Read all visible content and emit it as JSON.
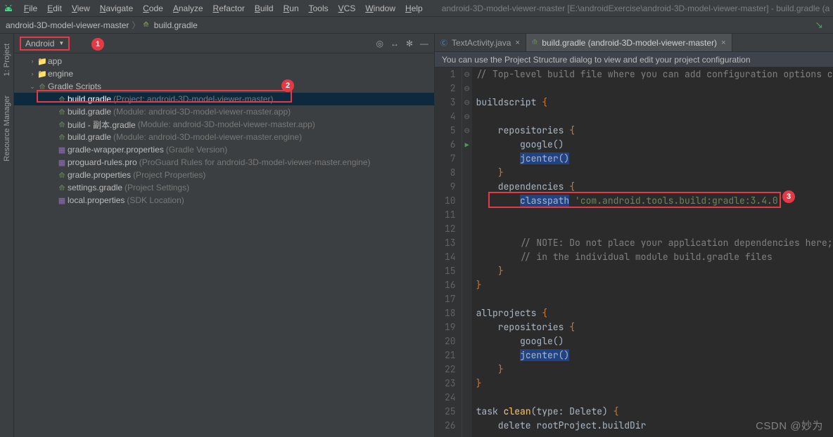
{
  "window_title": "android-3D-model-viewer-master [E:\\androidExercise\\android-3D-model-viewer-master] - build.gradle (android-",
  "menu": [
    "File",
    "Edit",
    "View",
    "Navigate",
    "Code",
    "Analyze",
    "Refactor",
    "Build",
    "Run",
    "Tools",
    "VCS",
    "Window",
    "Help"
  ],
  "breadcrumbs": {
    "project": "android-3D-model-viewer-master",
    "file": "build.gradle"
  },
  "sidebar_tools": {
    "project": "1: Project",
    "resource_manager": "Resource Manager"
  },
  "project_panel": {
    "view_mode": "Android"
  },
  "tree": [
    {
      "depth": 0,
      "arrow": "›",
      "icon": "folder",
      "label": "app",
      "hint": ""
    },
    {
      "depth": 0,
      "arrow": "›",
      "icon": "folder",
      "label": "engine",
      "hint": ""
    },
    {
      "depth": 0,
      "arrow": "⌄",
      "icon": "gradle",
      "label": "Gradle Scripts",
      "hint": ""
    },
    {
      "depth": 1,
      "arrow": "",
      "icon": "gradle",
      "label": "build.gradle",
      "hint": "(Project: android-3D-model-viewer-master)",
      "selected": true
    },
    {
      "depth": 1,
      "arrow": "",
      "icon": "gradle",
      "label": "build.gradle",
      "hint": "(Module: android-3D-model-viewer-master.app)"
    },
    {
      "depth": 1,
      "arrow": "",
      "icon": "gradle",
      "label": "build - 副本.gradle",
      "hint": "(Module: android-3D-model-viewer-master.app)"
    },
    {
      "depth": 1,
      "arrow": "",
      "icon": "gradle",
      "label": "build.gradle",
      "hint": "(Module: android-3D-model-viewer-master.engine)"
    },
    {
      "depth": 1,
      "arrow": "",
      "icon": "prop",
      "label": "gradle-wrapper.properties",
      "hint": "(Gradle Version)"
    },
    {
      "depth": 1,
      "arrow": "",
      "icon": "prop",
      "label": "proguard-rules.pro",
      "hint": "(ProGuard Rules for android-3D-model-viewer-master.engine)"
    },
    {
      "depth": 1,
      "arrow": "",
      "icon": "gradle",
      "label": "gradle.properties",
      "hint": "(Project Properties)"
    },
    {
      "depth": 1,
      "arrow": "",
      "icon": "gradle",
      "label": "settings.gradle",
      "hint": "(Project Settings)"
    },
    {
      "depth": 1,
      "arrow": "",
      "icon": "prop",
      "label": "local.properties",
      "hint": "(SDK Location)"
    }
  ],
  "tabs": [
    {
      "icon": "java",
      "label": "TextActivity.java",
      "active": false
    },
    {
      "icon": "gradle",
      "label": "build.gradle (android-3D-model-viewer-master)",
      "active": true
    }
  ],
  "infobar": "You can use the Project Structure dialog to view and edit your project configuration",
  "code": {
    "lines": [
      {
        "n": 1,
        "html": "<span class='cm'>// Top-level build file where you can add configuration options common</span>"
      },
      {
        "n": 2,
        "html": ""
      },
      {
        "n": 3,
        "html": "buildscript <span class='kw'>{</span>",
        "fold": "⊖"
      },
      {
        "n": 4,
        "html": ""
      },
      {
        "n": 5,
        "html": "    repositories <span class='kw'>{</span>",
        "fold": "⊖"
      },
      {
        "n": 6,
        "html": "        google()"
      },
      {
        "n": 7,
        "html": "        <span class='hlbox'>jcenter()</span>"
      },
      {
        "n": 8,
        "html": "    <span class='kw'>}</span>"
      },
      {
        "n": 9,
        "html": "    dependencies <span class='kw'>{</span>",
        "fold": "⊖"
      },
      {
        "n": 10,
        "html": "        <span class='hlbox'>classpath</span> <span class='str'>'com.android.tools.build:gradle:3.4.0'</span>"
      },
      {
        "n": 11,
        "html": ""
      },
      {
        "n": 12,
        "html": ""
      },
      {
        "n": 13,
        "html": "        <span class='cm'>// NOTE: Do not place your application dependencies here; they</span>"
      },
      {
        "n": 14,
        "html": "        <span class='cm'>// in the individual module build.gradle files</span>"
      },
      {
        "n": 15,
        "html": "    <span class='kw'>}</span>"
      },
      {
        "n": 16,
        "html": "<span class='kw'>}</span>"
      },
      {
        "n": 17,
        "html": ""
      },
      {
        "n": 18,
        "html": "allprojects <span class='kw'>{</span>",
        "fold": "⊖"
      },
      {
        "n": 19,
        "html": "    repositories <span class='kw'>{</span>",
        "fold": "⊖"
      },
      {
        "n": 20,
        "html": "        google()"
      },
      {
        "n": 21,
        "html": "        <span class='hlbox'>jcenter()</span>"
      },
      {
        "n": 22,
        "html": "    <span class='kw'>}</span>"
      },
      {
        "n": 23,
        "html": "<span class='kw'>}</span>"
      },
      {
        "n": 24,
        "html": ""
      },
      {
        "n": 25,
        "html": "task <span class='fn'>clean</span>(type: Delete) <span class='kw'>{</span>",
        "fold": "⊖",
        "run": true
      },
      {
        "n": 26,
        "html": "    delete rootProject.buildDir"
      }
    ]
  },
  "badges": {
    "1": "1",
    "2": "2",
    "3": "3"
  },
  "watermark": "CSDN @妙为"
}
